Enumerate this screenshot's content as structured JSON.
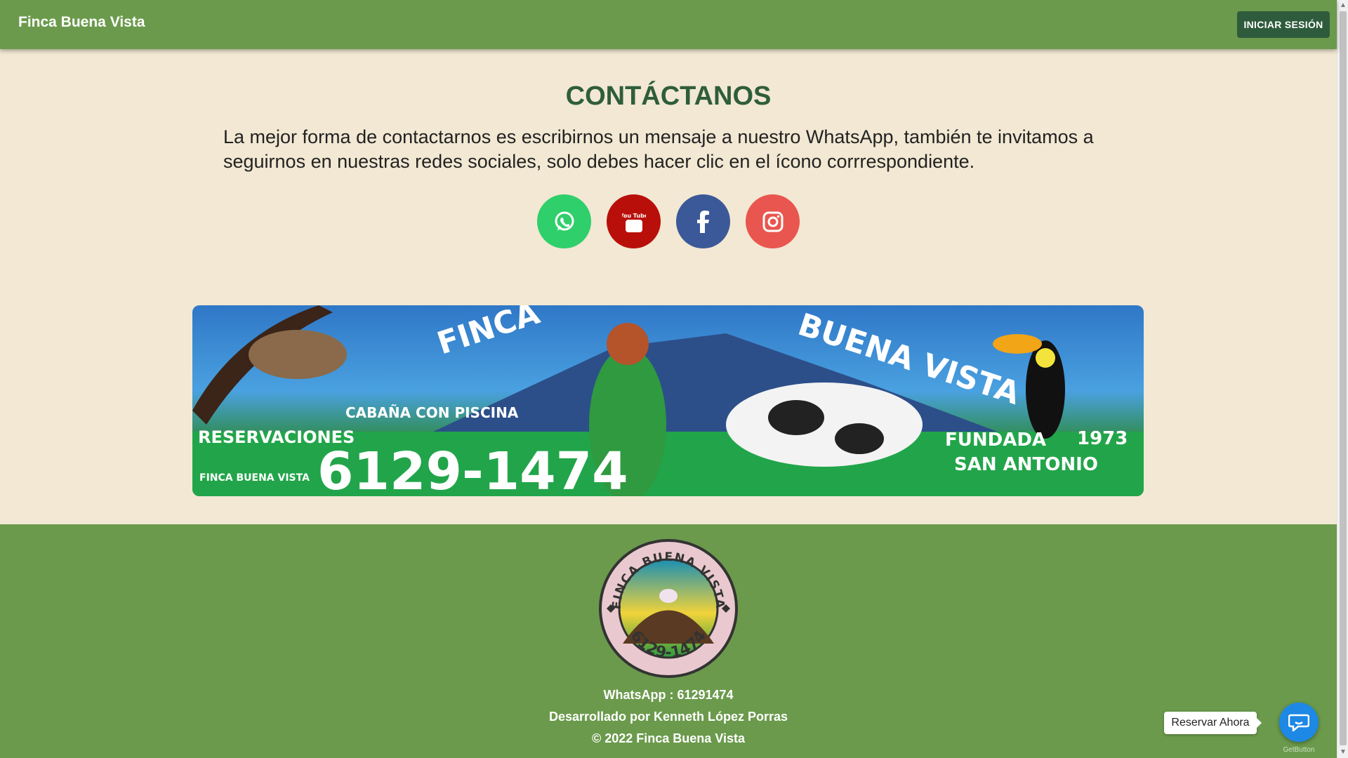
{
  "header": {
    "brand": "Finca Buena Vista",
    "login_label": "INICIAR SESIÓN"
  },
  "main": {
    "title": "CONTÁCTANOS",
    "intro": "La mejor forma de contactarnos es escribirnos un mensaje a nuestro WhatsApp, también te invitamos a seguirnos en nuestras redes sociales, solo debes hacer clic en el ícono corrrespondiente.",
    "social": [
      {
        "icon": "whatsapp-icon",
        "color": "#2fcf6b"
      },
      {
        "icon": "youtube-icon",
        "color": "#b80f0a",
        "text": "You Tube"
      },
      {
        "icon": "facebook-icon",
        "color": "#3b5998"
      },
      {
        "icon": "instagram-icon",
        "color": "#e9564f"
      }
    ]
  },
  "banner": {
    "finca": "FINCA",
    "buena_vista": "BUENA VISTA",
    "cabana": "CABAÑA CON PISCINA",
    "reservaciones": "RESERVACIONES",
    "facebook_name": "FINCA BUENA VISTA",
    "phone": "6129-1474",
    "fundada": "FUNDADA",
    "year": "1973",
    "place": "SAN ANTONIO"
  },
  "footer": {
    "logo_top": "FINCA BUENA VISTA",
    "logo_bottom": "6129-1474",
    "whatsapp": "WhatsApp : 61291474",
    "developer": "Desarrollado por Kenneth López Porras",
    "copyright": "© 2022 Finca Buena Vista"
  },
  "widget": {
    "reserve_label": "Reservar Ahora",
    "credit": "GetButton"
  },
  "colors": {
    "header": "#6b9a4c",
    "background": "#f2e8d3",
    "title": "#2f5d3a",
    "login_button": "#2e5b3c",
    "chat_button": "#1e88e5"
  }
}
